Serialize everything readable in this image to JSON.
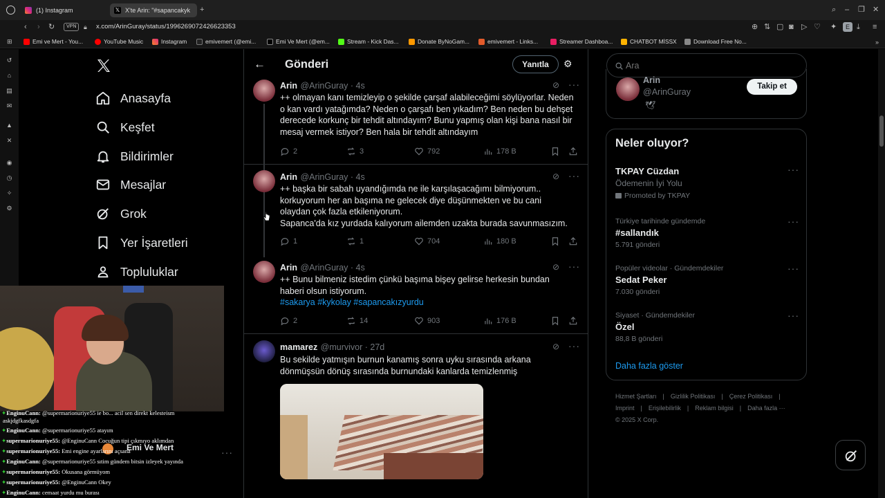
{
  "browser": {
    "tabs": [
      {
        "label": "(1) Instagram"
      },
      {
        "label": "X'te Arin: \"#sapancakyk"
      }
    ],
    "vpn_badge": "VPN",
    "url": "x.com/ArinGuray/status/1996269072426623353",
    "bookmarks": [
      {
        "label": "Emi ve Mert - You..."
      },
      {
        "label": "YouTube Music"
      },
      {
        "label": "Instagram"
      },
      {
        "label": "emivemert (@emi..."
      },
      {
        "label": "Emi Ve Mert (@em..."
      },
      {
        "label": "Stream - Kick Das..."
      },
      {
        "label": "Donate ByNoGam..."
      },
      {
        "label": "emivemert - Links..."
      },
      {
        "label": "Streamer Dashboa..."
      },
      {
        "label": "CHATBOT MİSSX"
      },
      {
        "label": "Download Free No..."
      }
    ],
    "profile_initial": "E"
  },
  "nav": {
    "items": [
      {
        "label": "Anasayfa"
      },
      {
        "label": "Keşfet"
      },
      {
        "label": "Bildirimler"
      },
      {
        "label": "Mesajlar"
      },
      {
        "label": "Grok"
      },
      {
        "label": "Yer İşaretleri"
      },
      {
        "label": "Topluluklar"
      }
    ]
  },
  "header": {
    "title": "Gönderi",
    "reply_button": "Yanıtla"
  },
  "tweets": [
    {
      "name": "Arin",
      "handle": "@ArinGuray · 4s",
      "text": "++ olmayan kanı temizleyip o şekilde çarşaf alabileceğimi söylüyorlar. Neden o kan vardı yatağımda? Neden o çarşafı ben yıkadım? Ben neden bu dehşet derecede korkunç bir tehdit altındayım? Bunu yapmış olan kişi bana nasıl bir mesaj vermek istiyor? Ben hala bir tehdit altındayım",
      "replies": "2",
      "reposts": "3",
      "likes": "792",
      "views": "178 B"
    },
    {
      "name": "Arin",
      "handle": "@ArinGuray · 4s",
      "text": "++ başka bir sabah uyandığımda ne ile karşılaşacağımı bilmiyorum.. korkuyorum her an başıma ne gelecek diye düşünmekten ve bu cani olaydan çok fazla etkileniyorum.",
      "text2": "Sapanca'da kız yurdada kalıyorum ailemden uzakta burada savunmasızım.",
      "replies": "1",
      "reposts": "1",
      "likes": "704",
      "views": "180 B"
    },
    {
      "name": "Arin",
      "handle": "@ArinGuray · 4s",
      "text": "++ Bunu bilmeniz istedim çünkü başıma bişey gelirse herkesin bundan haberi olsun istiyorum.",
      "tags": "#sakarya #kykolay #sapancakızyurdu",
      "replies": "2",
      "reposts": "14",
      "likes": "903",
      "views": "176 B"
    },
    {
      "name": "mamarez",
      "handle": "@murvivor · 27d",
      "text": "Bu sekilde yatmışın burnun kanamış sonra uyku sırasında arkana dönmüşsün dönüş sırasında burnundaki kanlarda temizlenmiş"
    }
  ],
  "search": {
    "placeholder": "Ara"
  },
  "profile_card": {
    "name": "Arin",
    "handle": "@ArinGuray",
    "follow_button": "Takip et"
  },
  "trends": {
    "title": "Neler oluyor?",
    "items": [
      {
        "meta": "",
        "title": "TKPAY Cüzdan",
        "subtitle": "Ödemenin İyi Yolu",
        "promoted": "Promoted by TKPAY"
      },
      {
        "meta": "Türkiye tarihinde gündemde",
        "title": "#sallandık",
        "count": "5.791 gönderi"
      },
      {
        "meta": "Popüler videolar · Gündemdekiler",
        "title": "Sedat Peker",
        "count": "7.030 gönderi"
      },
      {
        "meta": "Siyaset · Gündemdekiler",
        "title": "Özel",
        "count": "88,8 B gönderi"
      }
    ],
    "show_more": "Daha fazla göster"
  },
  "footer": {
    "links": [
      "Hizmet Şartları",
      "Gizlilik Politikası",
      "Çerez Politikası",
      "Imprint",
      "Erişilebilirlik",
      "Reklam bilgisi",
      "Daha fazla ···"
    ],
    "copyright": "© 2025 X Corp."
  },
  "stream_overlay": {
    "account_name": "Emi Ve Mert",
    "chat": [
      {
        "user": "EnginuCann:",
        "msg": "@supermarionuriye55 ie bo... acil sen direkt kelesteism"
      },
      {
        "user": "",
        "msg": "askjdgfkasdgfa"
      },
      {
        "user": "EnginuCann:",
        "msg": "@supermarionuriye55 atayım"
      },
      {
        "user": "supermarionuriye55:",
        "msg": "@EnginuCann Cocuğun tipi çıkmıyo aklımdan"
      },
      {
        "user": "supermarionuriye55:",
        "msg": "Emi engine ayarlarını açsana"
      },
      {
        "user": "EnginuCann:",
        "msg": "@supermarionuriye55 sıtim gündem bitsin izleyek yayında"
      },
      {
        "user": "supermarionuriye55:",
        "msg": "Okusana görmüyom"
      },
      {
        "user": "supermarionuriye55:",
        "msg": "@EnginuCann Okey"
      },
      {
        "user": "EnginuCann:",
        "msg": "cemaat yurdu mu burası"
      }
    ]
  },
  "colors": {
    "accent": "#1d9bf0",
    "bg": "#000000",
    "border": "#2f3336",
    "muted": "#71767b"
  }
}
